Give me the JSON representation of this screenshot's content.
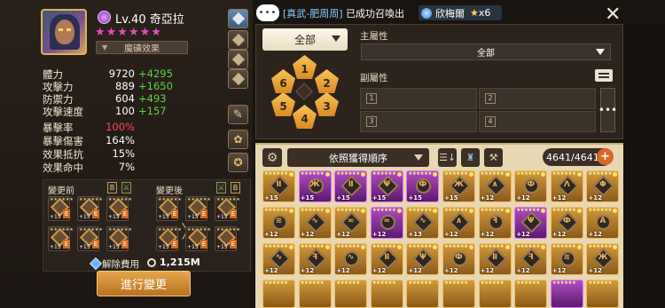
{
  "hero": {
    "level": "Lv.40",
    "name": "奇亞拉",
    "stars": "★★★★★★",
    "skill_effect_label": "魔礦效果"
  },
  "stats": [
    {
      "label": "體力",
      "value": "9720",
      "bonus": "+4295"
    },
    {
      "label": "攻擊力",
      "value": "889",
      "bonus": "+1650"
    },
    {
      "label": "防禦力",
      "value": "604",
      "bonus": "+493"
    },
    {
      "label": "攻擊速度",
      "value": "100",
      "bonus": "+157"
    },
    {
      "label": "暴擊率",
      "value": "100%",
      "bonus": "",
      "highlight": true
    },
    {
      "label": "暴擊傷害",
      "value": "164%",
      "bonus": ""
    },
    {
      "label": "效果抵抗",
      "value": "15%",
      "bonus": ""
    },
    {
      "label": "效果命中",
      "value": "7%",
      "bonus": ""
    }
  ],
  "change": {
    "before_label": "變更前",
    "after_label": "變更後",
    "b_tag": "B",
    "e_tag": "E",
    "rune_level": "+15",
    "cost_label": "解除費用",
    "cost_value": "1,215M",
    "proceed_label": "進行變更"
  },
  "chat": {
    "bubble": "•••",
    "prefix": "[真武-肥周周]",
    "message": "已成功召喚出",
    "monster": "欣梅爾",
    "star_count": "x6"
  },
  "rune_filter": {
    "set_label": "全部",
    "slots": [
      "1",
      "2",
      "3",
      "4",
      "5",
      "6"
    ],
    "main_stat_title": "主屬性",
    "main_stat_value": "全部",
    "sub_stat_title": "副屬性",
    "sub_slots": [
      "1",
      "2",
      "3",
      "4"
    ],
    "more": "•••"
  },
  "inventory": {
    "sort_label": "依照獲得順序",
    "count": "4641/4641",
    "add": "+",
    "runes": [
      {
        "grade": "leg",
        "lvl": "+15",
        "glyph": "Ⅱ"
      },
      {
        "grade": "her",
        "lvl": "+15",
        "glyph": "Ж"
      },
      {
        "grade": "her",
        "lvl": "+15",
        "glyph": "Ⅱ"
      },
      {
        "grade": "her",
        "lvl": "+15",
        "glyph": "Ψ"
      },
      {
        "grade": "her",
        "lvl": "+15",
        "glyph": "Ф"
      },
      {
        "grade": "leg",
        "lvl": "+15",
        "glyph": "Ж"
      },
      {
        "grade": "leg",
        "lvl": "+12",
        "glyph": "∧"
      },
      {
        "grade": "leg",
        "lvl": "+12",
        "glyph": "Ф"
      },
      {
        "grade": "leg",
        "lvl": "+12",
        "glyph": "Λ"
      },
      {
        "grade": "leg",
        "lvl": "+12",
        "glyph": "Φ"
      },
      {
        "grade": "leg",
        "lvl": "+12",
        "glyph": "≋"
      },
      {
        "grade": "leg",
        "lvl": "+12",
        "glyph": "∿"
      },
      {
        "grade": "leg",
        "lvl": "+12",
        "glyph": "∞"
      },
      {
        "grade": "her",
        "lvl": "+12",
        "glyph": "≈"
      },
      {
        "grade": "leg",
        "lvl": "+13",
        "glyph": "∿"
      },
      {
        "grade": "leg",
        "lvl": "+12",
        "glyph": "∧"
      },
      {
        "grade": "leg",
        "lvl": "+12",
        "glyph": "ꟻ"
      },
      {
        "grade": "her",
        "lvl": "+12",
        "glyph": "Ψ"
      },
      {
        "grade": "leg",
        "lvl": "+12",
        "glyph": "Ф"
      },
      {
        "grade": "leg",
        "lvl": "+12",
        "glyph": "A"
      },
      {
        "grade": "leg",
        "lvl": "+12",
        "glyph": "∿"
      },
      {
        "grade": "leg",
        "lvl": "+12",
        "glyph": "ꟻ"
      },
      {
        "grade": "leg",
        "lvl": "+12",
        "glyph": "∿"
      },
      {
        "grade": "leg",
        "lvl": "+12",
        "glyph": "Ⅱ"
      },
      {
        "grade": "leg",
        "lvl": "+12",
        "glyph": "Ψ"
      },
      {
        "grade": "leg",
        "lvl": "+12",
        "glyph": "Ф"
      },
      {
        "grade": "leg",
        "lvl": "+12",
        "glyph": "Ⅱ"
      },
      {
        "grade": "leg",
        "lvl": "+12",
        "glyph": "ꟻ"
      },
      {
        "grade": "leg",
        "lvl": "+12",
        "glyph": "≋"
      },
      {
        "grade": "leg",
        "lvl": "+12",
        "glyph": "Ж"
      }
    ]
  }
}
